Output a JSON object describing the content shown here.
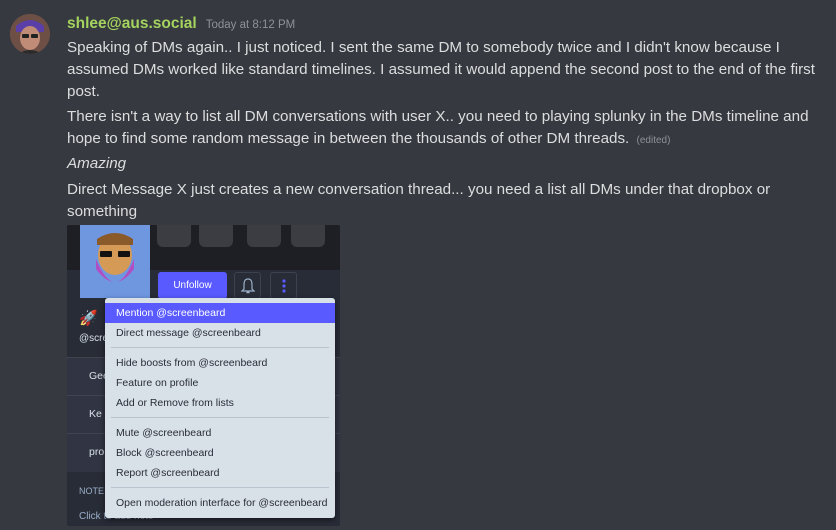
{
  "message": {
    "author": "shlee@aus.social",
    "timestamp": "Today at 8:12 PM",
    "paragraphs": [
      "Speaking of DMs again.. I just noticed. I sent the same DM to somebody twice and I didn't know because I assumed DMs worked like standard timelines.  I assumed it would append the second post to the end of the first post.",
      "There isn't a way to list all DM conversations with user X.. you need to playing splunky in the DMs timeline and hope to find some random message in between the thousands of other DM threads.",
      "Amazing",
      "Direct Message X just creates a new conversation thread... you need a list all DMs under that dropbox or something"
    ],
    "edited_label": "(edited)"
  },
  "attachment": {
    "unfollow_label": "Unfollow",
    "handle": "@scre",
    "fields": [
      "Gee",
      "Ke",
      "pro"
    ],
    "note_label": "NOTE",
    "note_placeholder": "Click to add note",
    "menu": {
      "items": [
        "Mention @screenbeard",
        "Direct message @screenbeard",
        "Hide boosts from @screenbeard",
        "Feature on profile",
        "Add or Remove from lists",
        "Mute @screenbeard",
        "Block @screenbeard",
        "Report @screenbeard",
        "Open moderation interface for @screenbeard"
      ],
      "active_index": 0
    }
  },
  "icons": {
    "bell": "bell-icon",
    "more": "more-vertical-icon",
    "rocket": "rocket-icon"
  },
  "colors": {
    "background": "#36393f",
    "username": "#a5d35f",
    "accent": "#595aff",
    "menu_bg": "#d9e1e8"
  }
}
